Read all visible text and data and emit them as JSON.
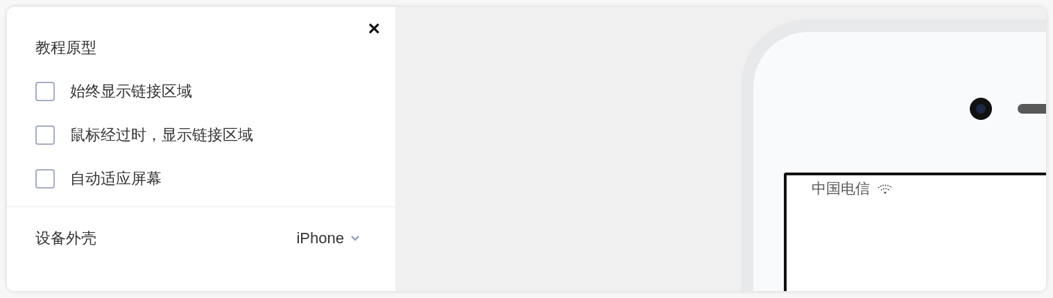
{
  "panel": {
    "title": "教程原型",
    "close": "×",
    "options": [
      {
        "label": "始终显示链接区域",
        "checked": false
      },
      {
        "label": "鼠标经过时，显示链接区域",
        "checked": false
      },
      {
        "label": "自动适应屏幕",
        "checked": false
      }
    ],
    "device": {
      "label": "设备外壳",
      "value": "iPhone"
    }
  },
  "preview": {
    "carrier": "中国电信"
  }
}
